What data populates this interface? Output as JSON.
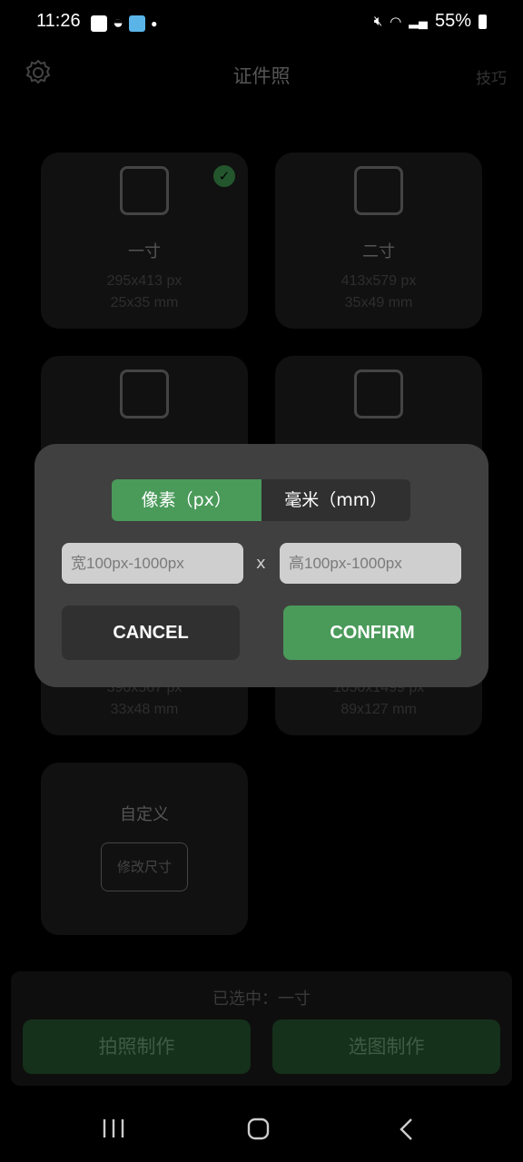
{
  "status": {
    "time": "11:26",
    "battery": "55%"
  },
  "header": {
    "title": "证件照",
    "tips": "技巧",
    "settings_icon": "gear-icon"
  },
  "cards": [
    {
      "name": "一寸",
      "px": "295x413 px",
      "mm": "25x35 mm",
      "selected": true
    },
    {
      "name": "二寸",
      "px": "413x579 px",
      "mm": "35x49 mm"
    },
    {
      "name": "",
      "px": "390x567 px",
      "mm": "33x48 mm"
    },
    {
      "name": "",
      "px": "1050x1499 px",
      "mm": "89x127 mm"
    }
  ],
  "custom": {
    "name": "自定义",
    "button": "修改尺寸"
  },
  "bottom": {
    "selected": "已选中：一寸",
    "camera": "拍照制作",
    "gallery": "选图制作"
  },
  "dialog": {
    "tab_px": "像素（px）",
    "tab_mm": "毫米（mm）",
    "active_tab": "px",
    "width_placeholder": "宽100px-1000px",
    "height_placeholder": "高100px-1000px",
    "separator": "x",
    "cancel": "CANCEL",
    "confirm": "CONFIRM"
  },
  "colors": {
    "accent": "#4a9a5a"
  }
}
